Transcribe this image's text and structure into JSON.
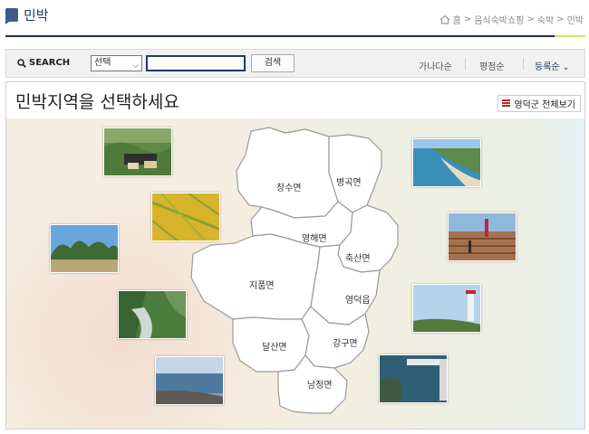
{
  "header": {
    "title": "민박",
    "breadcrumb": [
      "홈",
      "음식숙박쇼핑",
      "숙박",
      "민박"
    ]
  },
  "search": {
    "label": "SEARCH",
    "select_value": "선택",
    "input_value": "",
    "button_label": "검색"
  },
  "sort": {
    "options": [
      "가나다순",
      "평점순",
      "등록순"
    ],
    "active_index": 2
  },
  "main": {
    "heading": "민박지역을 선택하세요",
    "view_all_label": "영덕군 전체보기"
  },
  "districts": [
    "창수면",
    "병곡면",
    "영해면",
    "축산면",
    "지품면",
    "영덕읍",
    "달산면",
    "강구면",
    "남정면"
  ],
  "colors": {
    "accent": "#1f3a6b",
    "list_icon": "#c0272d"
  }
}
